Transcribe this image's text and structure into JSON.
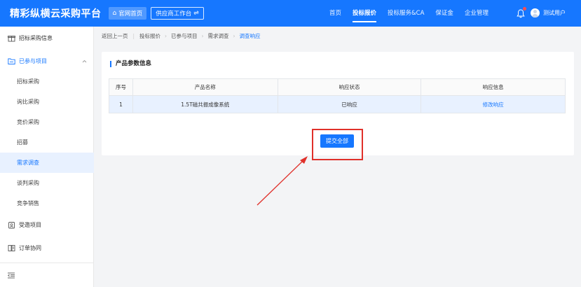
{
  "header": {
    "logo": "精彩纵横云采购平台",
    "home_label": "官网首页",
    "workbench_label": "供应商工作台",
    "nav": [
      "首页",
      "投标报价",
      "投标服务&CA",
      "保证金",
      "企业管理"
    ],
    "active_nav": "投标报价",
    "user_name": "测试用户"
  },
  "sidebar": {
    "items": [
      {
        "label": "招标采购信息",
        "icon": "gift-icon"
      },
      {
        "label": "已参与项目",
        "icon": "folder-icon"
      },
      {
        "label": "招标采购"
      },
      {
        "label": "询比采购"
      },
      {
        "label": "竞价采购"
      },
      {
        "label": "招募"
      },
      {
        "label": "需求调查"
      },
      {
        "label": "谈判采购"
      },
      {
        "label": "竞争销售"
      },
      {
        "label": "受邀项目",
        "icon": "invite-icon"
      },
      {
        "label": "订单协同",
        "icon": "order-icon"
      }
    ],
    "active_item": "需求调查"
  },
  "breadcrumb": {
    "back": "返回上一页",
    "items": [
      "投标报价",
      "已参与项目",
      "需求调查"
    ],
    "current": "调查响应"
  },
  "card": {
    "title": "产品参数信息",
    "columns": [
      "序号",
      "产品名称",
      "响应状态",
      "响应信息"
    ],
    "rows": [
      [
        "1",
        "1.5T磁共振成像系统",
        "已响应",
        "修改响应"
      ]
    ],
    "submit_label": "提交全部"
  },
  "colors": {
    "primary": "#1677ff",
    "highlight": "#e0302a",
    "active_bg": "#e8f1ff"
  }
}
